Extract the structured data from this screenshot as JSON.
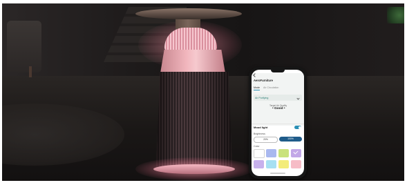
{
  "phone_app": {
    "header_title": "AeroFurniture",
    "tabs": [
      "Mode",
      "Air Circulation"
    ],
    "purify_mode": "Air Purifying",
    "subheading": "Target Air Quality",
    "subvalue": "• Good •",
    "mood_light": {
      "title": "Mood light",
      "toggle_on": true,
      "brightness_label": "Brightness",
      "brightness_options": [
        "20%",
        "100%"
      ],
      "brightness_selected": "100%",
      "color_label": "Color",
      "swatches": [
        "#ffffff",
        "#a9b8ef",
        "#c9e27c",
        "#c2a8e7",
        "#c7b1ec",
        "#a6e0f2",
        "#f3ec7a",
        "#f6bcc6"
      ],
      "selected_swatch_index": 3
    }
  },
  "colors": {
    "accent": "#2a8fb5",
    "button_active": "#1f5c8a",
    "glow": "#f5b8c2"
  }
}
